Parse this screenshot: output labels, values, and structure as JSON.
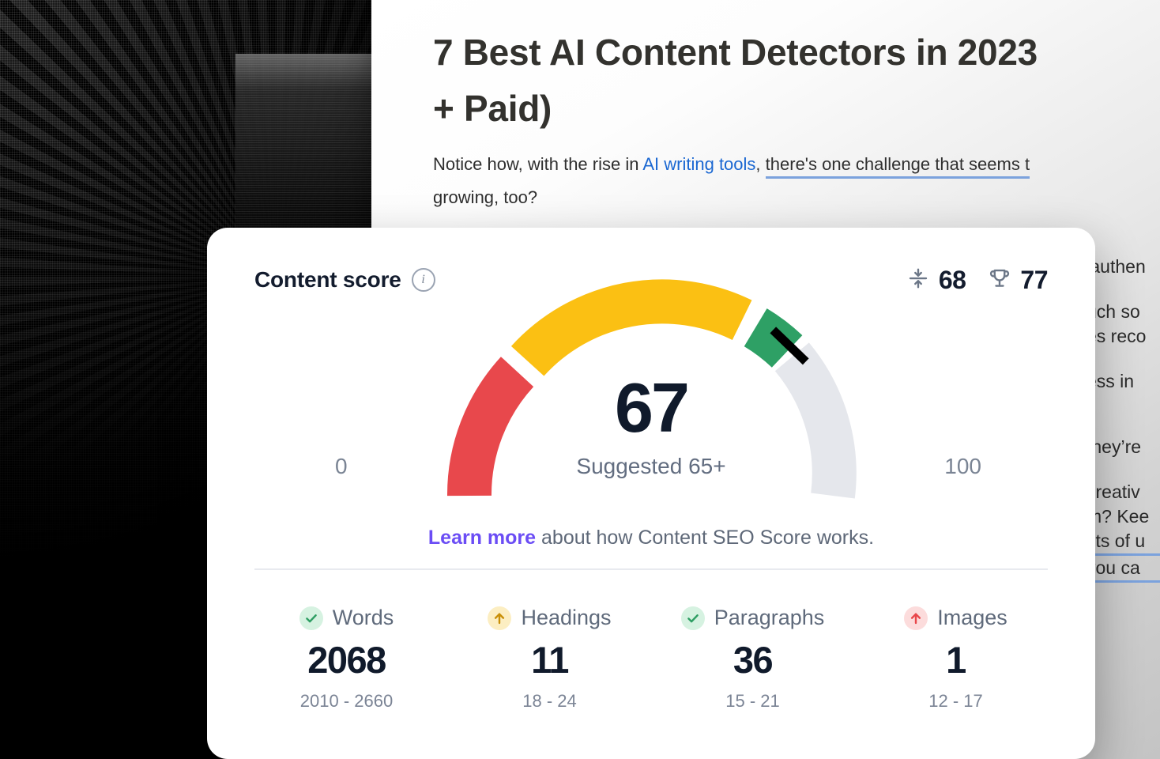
{
  "article": {
    "title_line1": "7 Best AI Content Detectors in 2023",
    "title_line2": "+ Paid)",
    "body_prefix": "Notice how, with the rise in ",
    "body_link": "AI writing tools",
    "body_comma": ", ",
    "body_underlined": "there's one challenge that seems t",
    "body_line2": "growing, too?",
    "side_fragments": [
      "'authen",
      "uch so",
      "es reco",
      "ess in",
      "they’re",
      " creativ",
      "m? Kee",
      "fits of u",
      "you ca"
    ],
    "link_color": "#1a67d2",
    "highlight_color": "#7ba2dd"
  },
  "card": {
    "header": {
      "title": "Content score",
      "info_icon": "info-icon",
      "stats": [
        {
          "icon": "readability-icon",
          "value": "68"
        },
        {
          "icon": "trophy-icon",
          "value": "77"
        }
      ]
    },
    "gauge": {
      "score": "67",
      "suggested_label": "Suggested 65+",
      "min_label": "0",
      "max_label": "100"
    },
    "learn_more": {
      "link_text": "Learn more",
      "rest_text": " about how Content SEO Score works.",
      "link_color": "#6b4df5"
    },
    "metrics": [
      {
        "label": "Words",
        "value": "2068",
        "range": "2010 - 2660",
        "status": "good",
        "icon": "check-icon",
        "badge_bg": "#d6f2e1",
        "icon_color": "#2e9e63"
      },
      {
        "label": "Headings",
        "value": "11",
        "range": "18 - 24",
        "status": "warning",
        "icon": "arrow-up-icon",
        "badge_bg": "#fceec2",
        "icon_color": "#c98f07"
      },
      {
        "label": "Paragraphs",
        "value": "36",
        "range": "15 - 21",
        "status": "good",
        "icon": "check-icon",
        "badge_bg": "#d6f2e1",
        "icon_color": "#2e9e63"
      },
      {
        "label": "Images",
        "value": "1",
        "range": "12 - 17",
        "status": "bad",
        "icon": "arrow-up-icon",
        "badge_bg": "#fcdcdc",
        "icon_color": "#e8464a"
      }
    ]
  },
  "chart_data": {
    "type": "gauge",
    "title": "Content score",
    "value": 67,
    "min": 0,
    "max": 100,
    "suggested_threshold": 65,
    "needle_value": 67,
    "bands": [
      {
        "name": "poor",
        "from": 0,
        "to": 34,
        "color": "#e8484c"
      },
      {
        "name": "average",
        "from": 36,
        "to": 60,
        "color": "#fbc013"
      },
      {
        "name": "good",
        "from": 62,
        "to": 67,
        "color": "#2ea065"
      },
      {
        "name": "empty",
        "from": 68,
        "to": 100,
        "color": "#e5e7ec"
      }
    ],
    "tick_labels": [
      "0",
      "100"
    ],
    "annotation": "Suggested 65+"
  }
}
